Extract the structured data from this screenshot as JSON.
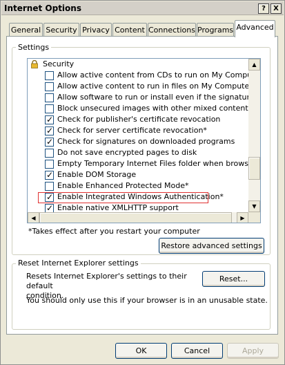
{
  "window": {
    "title": "Internet Options",
    "help_button": "?",
    "close_button": "X"
  },
  "tabs": [
    {
      "label": "General"
    },
    {
      "label": "Security"
    },
    {
      "label": "Privacy"
    },
    {
      "label": "Content"
    },
    {
      "label": "Connections"
    },
    {
      "label": "Programs"
    },
    {
      "label": "Advanced"
    }
  ],
  "active_tab": "Advanced",
  "settings_group": {
    "label": "Settings",
    "category_icon": "lock-icon",
    "category": "Security",
    "items": [
      {
        "label": "Allow active content from CDs to run on My Computer*",
        "checked": false
      },
      {
        "label": "Allow active content to run in files on My Computer*",
        "checked": false
      },
      {
        "label": "Allow software to run or install even if the signature is inva",
        "checked": false
      },
      {
        "label": "Block unsecured images with other mixed content",
        "checked": false
      },
      {
        "label": "Check for publisher's certificate revocation",
        "checked": true
      },
      {
        "label": "Check for server certificate revocation*",
        "checked": true
      },
      {
        "label": "Check for signatures on downloaded programs",
        "checked": true
      },
      {
        "label": "Do not save encrypted pages to disk",
        "checked": false
      },
      {
        "label": "Empty Temporary Internet Files folder when browser is clo",
        "checked": false
      },
      {
        "label": "Enable DOM Storage",
        "checked": true
      },
      {
        "label": "Enable Enhanced Protected Mode*",
        "checked": false
      },
      {
        "label": "Enable Integrated Windows Authentication*",
        "checked": true,
        "highlighted": true
      },
      {
        "label": "Enable native XMLHTTP support",
        "checked": true
      }
    ],
    "footnote": "*Takes effect after you restart your computer",
    "restore_button": "Restore advanced settings"
  },
  "reset_group": {
    "label": "Reset Internet Explorer settings",
    "description": "Resets Internet Explorer's settings to their default condition.",
    "description_line1": "Resets Internet Explorer's settings to their default",
    "description_line2": "condition.",
    "reset_button": "Reset...",
    "warning": "You should only use this if your browser is in an unusable state."
  },
  "footer": {
    "ok": "OK",
    "cancel": "Cancel",
    "apply": "Apply"
  },
  "colors": {
    "highlight_border": "#e03030",
    "dialog_face": "#ece9d8"
  }
}
